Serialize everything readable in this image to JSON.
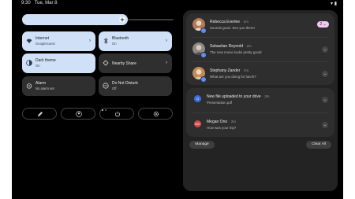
{
  "status": {
    "time": "9:30",
    "date": "Tue, Mar 8"
  },
  "brightness": {
    "level": 0.45
  },
  "tiles": [
    {
      "title": "Internet",
      "subtitle": "GoogleGuest",
      "icon": "wifi-icon",
      "state": "on",
      "chevron": true
    },
    {
      "title": "Bluetooth",
      "subtitle": "On",
      "icon": "bluetooth-icon",
      "state": "on",
      "chevron": true
    },
    {
      "title": "Dark theme",
      "subtitle": "On",
      "icon": "dark-theme-icon",
      "state": "on",
      "chevron": false
    },
    {
      "title": "Nearby Share",
      "subtitle": "",
      "icon": "nearby-share-icon",
      "state": "off",
      "chevron": true
    },
    {
      "title": "Alarm",
      "subtitle": "No alarm set",
      "icon": "alarm-icon",
      "state": "off",
      "chevron": false
    },
    {
      "title": "Do Not Disturb",
      "subtitle": "Off",
      "icon": "do-not-disturb-icon",
      "state": "off",
      "chevron": false
    }
  ],
  "actions": [
    "edit-icon",
    "user-icon",
    "power-icon",
    "settings-icon"
  ],
  "conversations": [
    {
      "name": "Rebecca Everlee",
      "time": "· 2m",
      "message": "Sounds good. See you there!",
      "count": "2",
      "avatar_color": "#b07a5a"
    },
    {
      "name": "Sebastian Reynold",
      "time": "· 2m",
      "message": "The new movie looks pretty good!",
      "avatar_color": "#8a8a8a"
    },
    {
      "name": "Stephany Zander",
      "time": "· 2m",
      "message": "What are you doing for lunch?",
      "avatar_color": "#c08a5a"
    }
  ],
  "alerts": [
    {
      "title": "New file uploaded to your drive",
      "time": "· 2m",
      "message": "Presentation.pdf",
      "icon_color": "#3b6fe0",
      "icon_label": "G"
    },
    {
      "title": "Megan Ono",
      "time": "· 2m",
      "message": "How was your trip?",
      "icon_color": "#c94a4a",
      "icon_label": "MO"
    }
  ],
  "buttons": {
    "manage": "Manage",
    "clear_all": "Clear All"
  },
  "colors": {
    "accent_tile": "#cfe0f7",
    "background": "#000000"
  }
}
